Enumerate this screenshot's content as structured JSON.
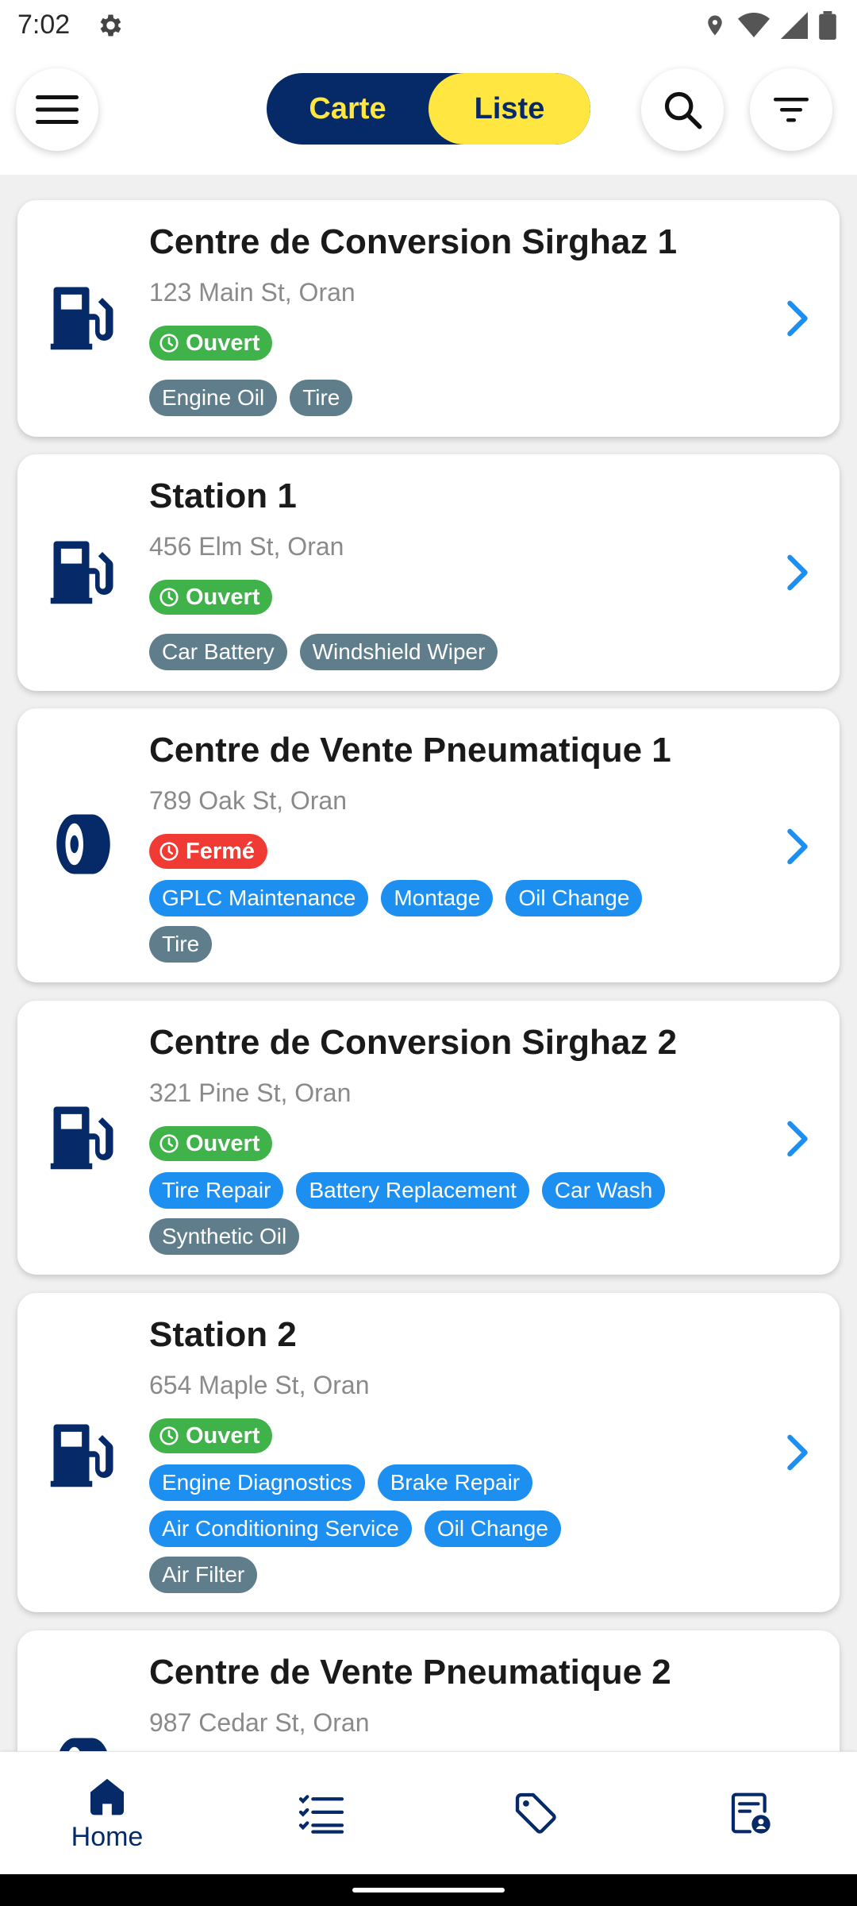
{
  "status_bar": {
    "time": "7:02"
  },
  "app_bar": {
    "segments": {
      "map": "Carte",
      "list": "Liste"
    }
  },
  "stations": [
    {
      "title": "Centre de Conversion Sirghaz 1",
      "address": "123 Main St, Oran",
      "status": "Ouvert",
      "icon": "fuel-pump-icon",
      "tags": [
        {
          "label": "Engine Oil",
          "style": "grey"
        },
        {
          "label": "Tire",
          "style": "grey"
        }
      ]
    },
    {
      "title": "Station 1",
      "address": "456 Elm St, Oran",
      "status": "Ouvert",
      "icon": "fuel-pump-icon",
      "tags": [
        {
          "label": "Car Battery",
          "style": "grey"
        },
        {
          "label": "Windshield Wiper",
          "style": "grey"
        }
      ]
    },
    {
      "title": "Centre de Vente Pneumatique 1",
      "address": "789 Oak St, Oran",
      "status": "Fermé",
      "icon": "tire-icon",
      "tags": [
        {
          "label": "GPLC Maintenance",
          "style": "blue"
        },
        {
          "label": "Montage",
          "style": "blue"
        },
        {
          "label": "Oil Change",
          "style": "blue"
        },
        {
          "label": "Tire",
          "style": "grey"
        }
      ]
    },
    {
      "title": "Centre de Conversion Sirghaz 2",
      "address": "321 Pine St, Oran",
      "status": "Ouvert",
      "icon": "fuel-pump-icon",
      "tags": [
        {
          "label": "Tire Repair",
          "style": "blue"
        },
        {
          "label": "Battery Replacement",
          "style": "blue"
        },
        {
          "label": "Car Wash",
          "style": "blue"
        },
        {
          "label": "Synthetic Oil",
          "style": "grey"
        }
      ]
    },
    {
      "title": "Station 2",
      "address": "654 Maple St, Oran",
      "status": "Ouvert",
      "icon": "fuel-pump-icon",
      "tags": [
        {
          "label": "Engine Diagnostics",
          "style": "blue"
        },
        {
          "label": "Brake Repair",
          "style": "blue"
        },
        {
          "label": "Air Conditioning Service",
          "style": "blue"
        },
        {
          "label": "Oil Change",
          "style": "blue"
        },
        {
          "label": "Air Filter",
          "style": "grey"
        }
      ]
    },
    {
      "title": "Centre de Vente Pneumatique 2",
      "address": "987 Cedar St, Oran",
      "icon": "tire-icon"
    }
  ],
  "bottom_nav": {
    "home": "Home"
  },
  "colors": {
    "navy": "#062a68",
    "yellow": "#ffe640",
    "open": "#3fb24a",
    "closed": "#ef3b34",
    "tag_blue": "#1d8ff1",
    "tag_grey": "#607d8b",
    "chevron": "#1d8ff1"
  }
}
